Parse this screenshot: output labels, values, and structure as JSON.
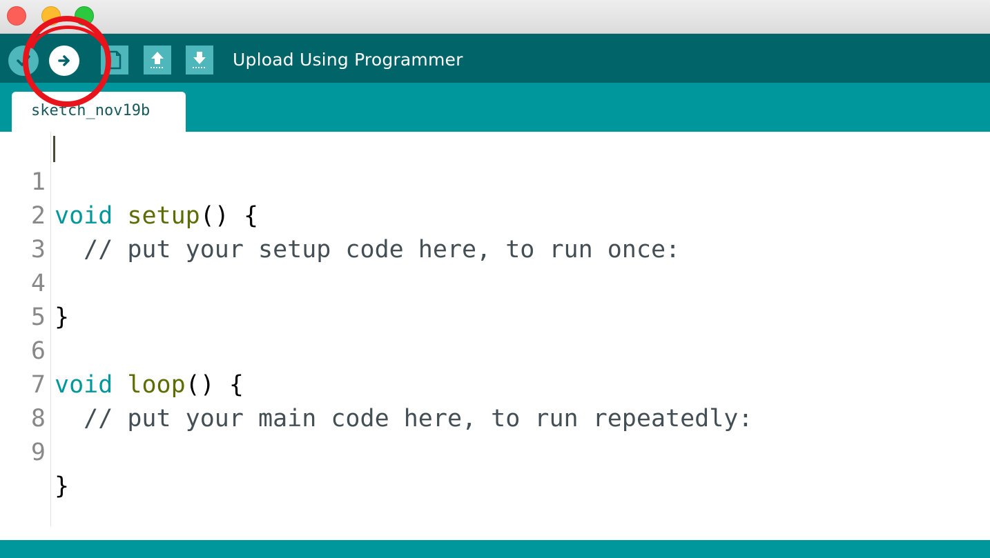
{
  "window": {
    "traffic_lights": [
      "close",
      "minimize",
      "zoom"
    ]
  },
  "toolbar": {
    "buttons": [
      {
        "name": "verify",
        "icon": "checkmark-icon"
      },
      {
        "name": "upload",
        "icon": "right-arrow-icon"
      },
      {
        "name": "new",
        "icon": "document-icon"
      },
      {
        "name": "open",
        "icon": "up-arrow-icon"
      },
      {
        "name": "save",
        "icon": "down-arrow-icon"
      }
    ],
    "hover_label": "Upload Using Programmer"
  },
  "tabs": [
    {
      "label": "sketch_nov19b",
      "active": true
    }
  ],
  "editor": {
    "lines": [
      {
        "num": "1",
        "type": "void",
        "fn": "setup",
        "rest": "() {"
      },
      {
        "num": "2",
        "text": "  // put your setup code here, to run once:"
      },
      {
        "num": "3",
        "text": ""
      },
      {
        "num": "4",
        "text": "}"
      },
      {
        "num": "5",
        "text": ""
      },
      {
        "num": "6",
        "type": "void",
        "fn": "loop",
        "rest": "() {"
      },
      {
        "num": "7",
        "text": "  // put your main code here, to run repeatedly:"
      },
      {
        "num": "8",
        "text": ""
      },
      {
        "num": "9",
        "text": "}"
      }
    ]
  },
  "colors": {
    "toolbar_bg": "#006468",
    "tab_strip_bg": "#00979c",
    "button_bg": "#4db7bb",
    "keyword_type": "#00979c",
    "keyword_function": "#5e6d03",
    "annotation": "#e8131b"
  },
  "annotation": {
    "shape": "circle",
    "target": "upload-button",
    "color": "red"
  }
}
